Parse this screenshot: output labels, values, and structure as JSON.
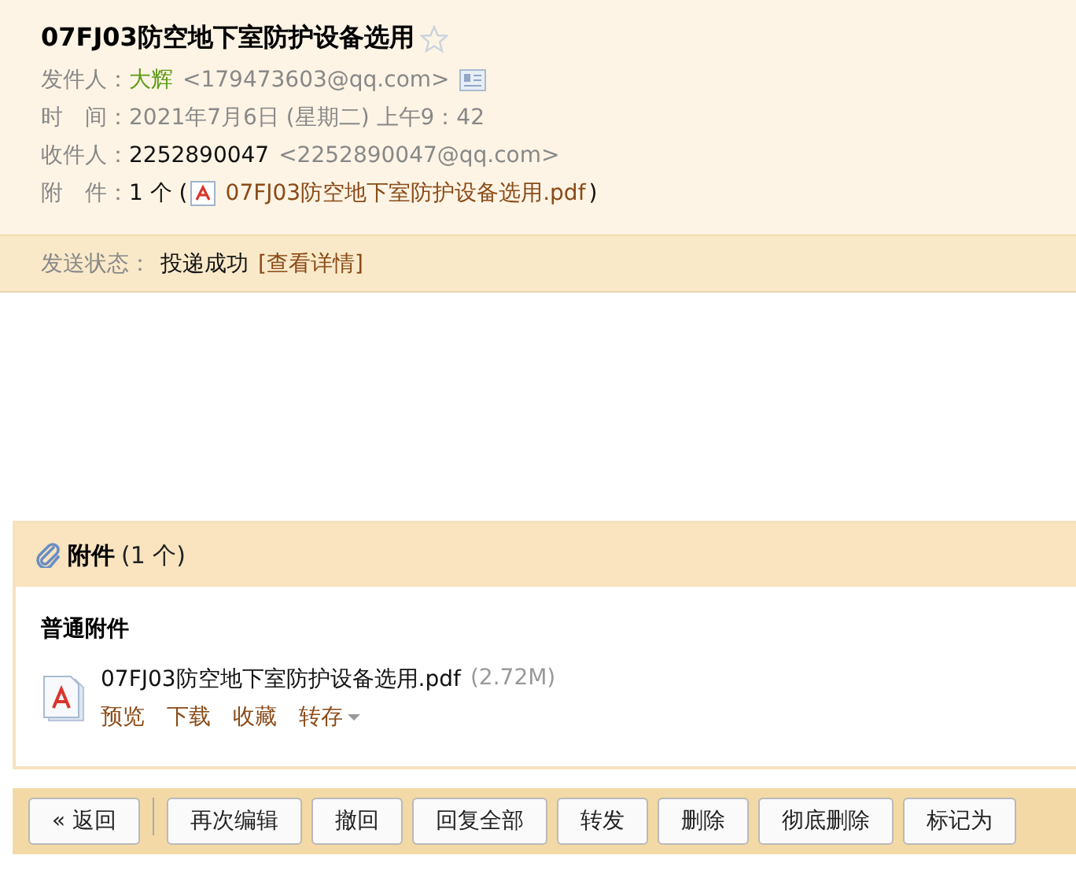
{
  "mail": {
    "subject": "07FJ03防空地下室防护设备选用",
    "starred": false,
    "sender": {
      "label": "发件人：",
      "name": "大辉",
      "address": "<179473603@qq.com>"
    },
    "time": {
      "label": "时　间：",
      "value": "2021年7月6日 (星期二) 上午9：42"
    },
    "recipient": {
      "label": "收件人：",
      "name": "2252890047",
      "address": "<2252890047@qq.com>"
    },
    "attachment_line": {
      "label": "附　件：",
      "count": "1 个 (",
      "file": "07FJ03防空地下室防护设备选用.pdf",
      "close": ")"
    },
    "status": {
      "label": "发送状态：",
      "value": "投递成功",
      "link": "[查看详情]"
    }
  },
  "attachments": {
    "title": "附件",
    "count": "(1 个)",
    "group": "普通附件",
    "files": [
      {
        "name": "07FJ03防空地下室防护设备选用.pdf",
        "size": "(2.72M)",
        "actions": [
          "预览",
          "下载",
          "收藏",
          "转存"
        ]
      }
    ]
  },
  "toolbar": [
    "« 返回",
    "再次编辑",
    "撤回",
    "回复全部",
    "转发",
    "删除",
    "彻底删除",
    "标记为"
  ]
}
